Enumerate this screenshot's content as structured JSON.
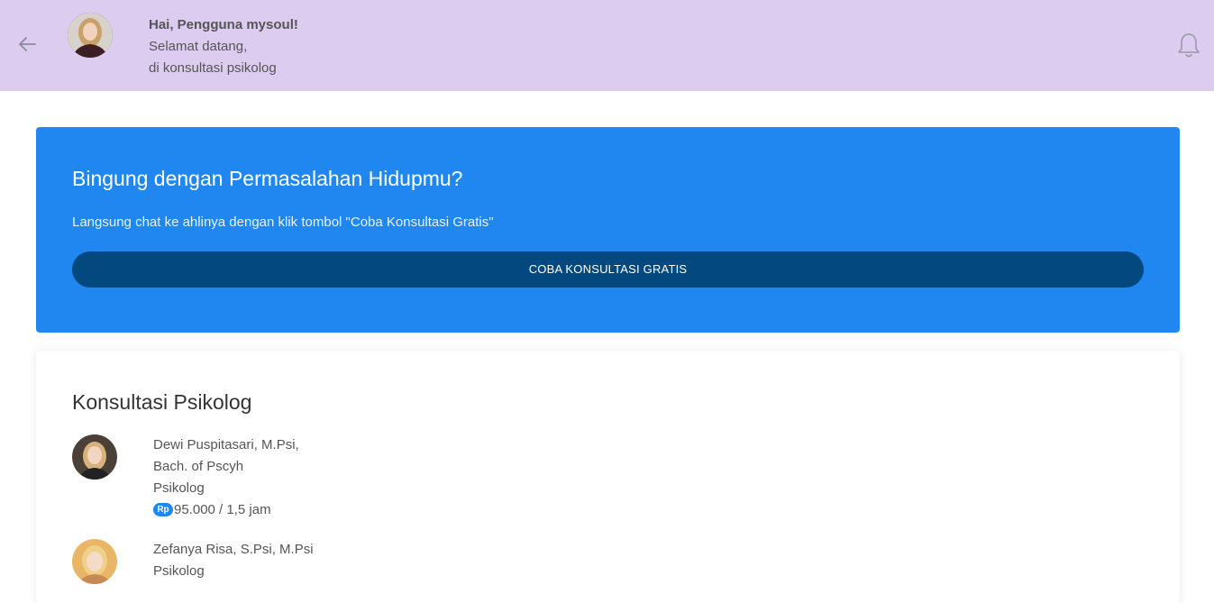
{
  "header": {
    "greeting_name": "Hai, Pengguna mysoul!",
    "greeting_line2": "Selamat datang,",
    "greeting_line3": "di konsultasi psikolog",
    "back_icon": "arrow-left-icon",
    "bell_icon": "bell-icon",
    "background_color": "#dccdf0"
  },
  "banner": {
    "title": "Bingung dengan Permasalahan Hidupmu?",
    "subtitle": "Langsung chat ke ahlinya dengan klik tombol \"Coba Konsultasi Gratis\"",
    "button_label": "COBA KONSULTASI GRATIS",
    "background_color": "#1f87ef",
    "button_color": "#03497f"
  },
  "consult": {
    "title": "Konsultasi Psikolog",
    "doctors": [
      {
        "name_line1": "Dewi Puspitasari, M.Psi,",
        "name_line2": "Bach. of Pscyh",
        "role": "Psikolog",
        "currency_badge": "Rp",
        "price": "95.000 / 1,5 jam"
      },
      {
        "name_line1": "Zefanya Risa, S.Psi, M.Psi",
        "role": "Psikolog"
      }
    ]
  }
}
